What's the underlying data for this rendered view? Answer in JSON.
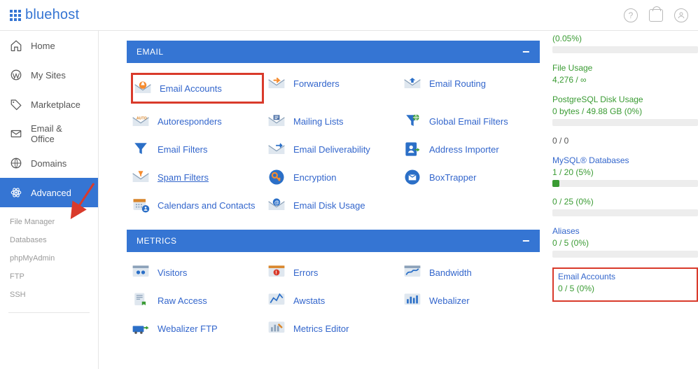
{
  "brand": "bluehost",
  "sidebar": {
    "items": [
      {
        "label": "Home"
      },
      {
        "label": "My Sites"
      },
      {
        "label": "Marketplace"
      },
      {
        "label": "Email & Office"
      },
      {
        "label": "Domains"
      },
      {
        "label": "Advanced"
      }
    ],
    "sub": [
      {
        "label": "File Manager"
      },
      {
        "label": "Databases"
      },
      {
        "label": "phpMyAdmin"
      },
      {
        "label": "FTP"
      },
      {
        "label": "SSH"
      }
    ]
  },
  "panels": {
    "email": {
      "heading": "EMAIL"
    },
    "metrics": {
      "heading": "METRICS"
    }
  },
  "email_items": [
    {
      "label": "Email Accounts",
      "highlight": true
    },
    {
      "label": "Forwarders"
    },
    {
      "label": "Email Routing"
    },
    {
      "label": "Autoresponders"
    },
    {
      "label": "Mailing Lists"
    },
    {
      "label": "Global Email Filters"
    },
    {
      "label": "Email Filters"
    },
    {
      "label": "Email Deliverability"
    },
    {
      "label": "Address Importer"
    },
    {
      "label": "Spam Filters",
      "underline": true
    },
    {
      "label": "Encryption"
    },
    {
      "label": "BoxTrapper"
    },
    {
      "label": "Calendars and Contacts"
    },
    {
      "label": "Email Disk Usage"
    }
  ],
  "metric_items": [
    {
      "label": "Visitors"
    },
    {
      "label": "Errors"
    },
    {
      "label": "Bandwidth"
    },
    {
      "label": "Raw Access"
    },
    {
      "label": "Awstats"
    },
    {
      "label": "Webalizer"
    },
    {
      "label": "Webalizer FTP"
    },
    {
      "label": "Metrics Editor"
    }
  ],
  "stats": {
    "top_pct": "(0.05%)",
    "file_usage": {
      "title": "File Usage",
      "value": "4,276 / ∞"
    },
    "pg": {
      "title": "PostgreSQL Disk Usage",
      "value": "0 bytes / 49.88 GB   (0%)"
    },
    "unnamed": {
      "value": "0 / 0"
    },
    "mysql": {
      "title": "MySQL® Databases",
      "value": "1 / 20   (5%)",
      "fill": 5
    },
    "q25": {
      "value": "0 / 25   (0%)"
    },
    "aliases": {
      "title": "Aliases",
      "value": "0 / 5   (0%)"
    },
    "emailacc": {
      "title": "Email Accounts",
      "value": "0 / 5   (0%)"
    }
  }
}
